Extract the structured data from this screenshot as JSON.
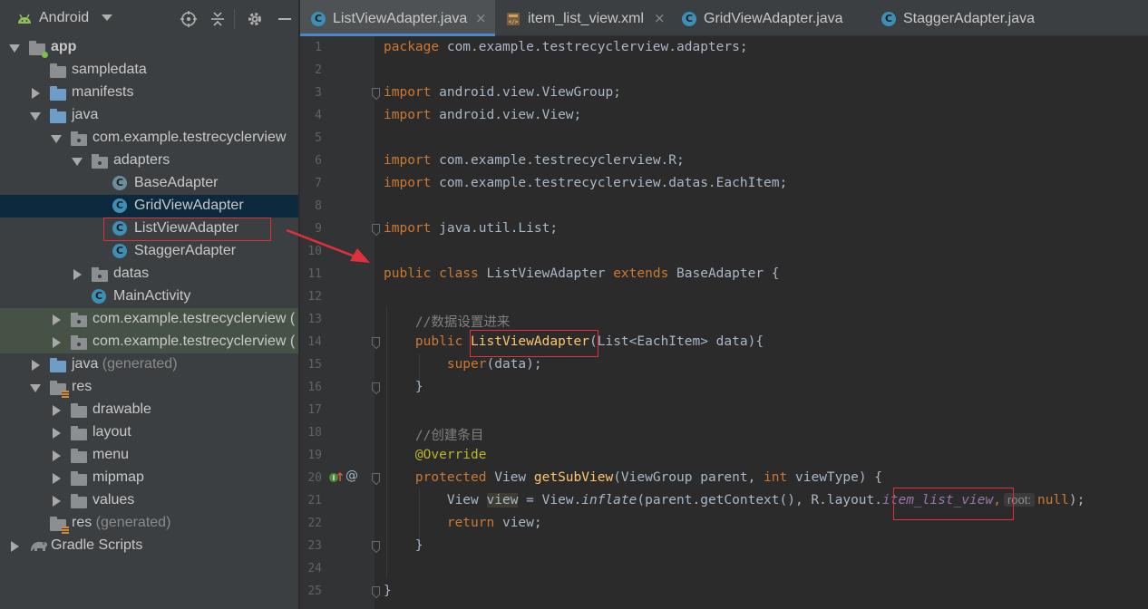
{
  "project_panel": {
    "view_title": "Android",
    "tree": [
      {
        "label": "app",
        "depth": 0,
        "icon": "module-folder-icon",
        "expanded": true,
        "bold": true
      },
      {
        "label": "sampledata",
        "depth": 1,
        "icon": "folder-gray-icon"
      },
      {
        "label": "manifests",
        "depth": 1,
        "icon": "folder-icon",
        "expanded": false
      },
      {
        "label": "java",
        "depth": 1,
        "icon": "folder-icon",
        "expanded": true
      },
      {
        "label": "com.example.testrecyclerview",
        "depth": 2,
        "icon": "package-icon",
        "expanded": true
      },
      {
        "label": "adapters",
        "depth": 3,
        "icon": "package-icon",
        "expanded": true
      },
      {
        "label": "BaseAdapter",
        "depth": 4,
        "icon": "abstract-class-icon"
      },
      {
        "label": "GridViewAdapter",
        "depth": 4,
        "icon": "class-icon",
        "selected": true
      },
      {
        "label": "ListViewAdapter",
        "depth": 4,
        "icon": "class-icon",
        "annotated": true
      },
      {
        "label": "StaggerAdapter",
        "depth": 4,
        "icon": "class-icon"
      },
      {
        "label": "datas",
        "depth": 3,
        "icon": "package-icon",
        "expanded": false
      },
      {
        "label": "MainActivity",
        "depth": 3,
        "icon": "class-icon"
      },
      {
        "label": "com.example.testrecyclerview (",
        "depth": 2,
        "icon": "package-icon",
        "expanded": false,
        "shaded": true
      },
      {
        "label": "com.example.testrecyclerview (",
        "depth": 2,
        "icon": "package-icon",
        "expanded": false,
        "shaded": true
      },
      {
        "label": "java",
        "generated": "(generated)",
        "depth": 1,
        "icon": "folder-icon",
        "expanded": false
      },
      {
        "label": "res",
        "depth": 1,
        "icon": "res-folder-icon",
        "expanded": true
      },
      {
        "label": "drawable",
        "depth": 2,
        "icon": "folder-gray-icon",
        "expanded": false
      },
      {
        "label": "layout",
        "depth": 2,
        "icon": "folder-gray-icon",
        "expanded": false
      },
      {
        "label": "menu",
        "depth": 2,
        "icon": "folder-gray-icon",
        "expanded": false
      },
      {
        "label": "mipmap",
        "depth": 2,
        "icon": "folder-gray-icon",
        "expanded": false
      },
      {
        "label": "values",
        "depth": 2,
        "icon": "folder-gray-icon",
        "expanded": false
      },
      {
        "label": "res",
        "generated": "(generated)",
        "depth": 1,
        "icon": "res-folder-icon"
      },
      {
        "label": "Gradle Scripts",
        "depth": 0,
        "icon": "gradle-elephant-icon",
        "expanded": false
      }
    ]
  },
  "tabs": [
    {
      "label": "ListViewAdapter.java",
      "icon": "class-icon",
      "active": true,
      "close": "×"
    },
    {
      "label": "item_list_view.xml",
      "icon": "xml-layout-icon",
      "active": false,
      "close": "×"
    },
    {
      "label": "GridViewAdapter.java",
      "icon": "class-icon",
      "active": false
    },
    {
      "label": "StaggerAdapter.java",
      "icon": "class-icon",
      "active": false
    }
  ],
  "editor": {
    "line_numbers": [
      "1",
      "2",
      "3",
      "4",
      "5",
      "6",
      "7",
      "8",
      "9",
      "10",
      "11",
      "12",
      "13",
      "14",
      "15",
      "16",
      "17",
      "18",
      "19",
      "20",
      "21",
      "22",
      "23",
      "24",
      "25"
    ],
    "tokens": {
      "package_kw": "package",
      "package_name": " com.example.testrecyclerview.adapters;",
      "import_kw": "import",
      "import_1": " android.view.ViewGroup;",
      "import_2": " android.view.View;",
      "import_3": " com.example.testrecyclerview.R;",
      "import_4": " com.example.testrecyclerview.datas.EachItem;",
      "import_5": " java.util.List;",
      "public_kw": "public",
      "class_kw": " class",
      "class_name": " ListViewAdapter ",
      "extends_kw": "extends",
      "base_class": " BaseAdapter {",
      "comment_1": "//数据设置进来",
      "ctor_name": "ListViewAdapter",
      "ctor_params": "(List<EachItem> data){",
      "super_kw": "super",
      "super_args": "(data);",
      "close_brace": "}",
      "comment_2": "//创建条目",
      "override": "@Override",
      "protected_kw": "protected",
      "view_type": " View ",
      "method_name": "getSubView",
      "method_params_1": "(ViewGroup parent, ",
      "int_kw": "int",
      "method_params_2": " viewType) {",
      "view_decl": "View ",
      "view_var": "view",
      "assign": " = View.",
      "inflate": "inflate",
      "inflate_args_1": "(parent.getContext(), R.layout.",
      "layout_field": "item_list_view",
      "comma": ",",
      "root_hint": "root:",
      "null_kw": "null",
      "end_paren": ");",
      "return_kw": "return",
      "return_val": " view;"
    }
  }
}
